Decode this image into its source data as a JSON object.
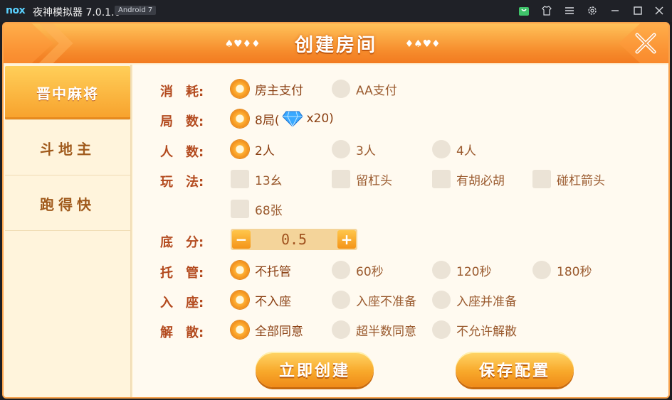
{
  "titlebar": {
    "logo": "nox",
    "app_title": "夜神模拟器 7.0.1.0",
    "android_badge": "Android 7",
    "icons": [
      "shop-icon",
      "shirt-icon",
      "menu-icon",
      "gear-icon",
      "minimize-icon",
      "maximize-icon",
      "close-icon"
    ]
  },
  "dialog": {
    "title": "创建房间",
    "close_icon": "close-x-icon"
  },
  "tabs": [
    {
      "label": "晋中麻将",
      "active": true
    },
    {
      "label": "斗地主",
      "active": false
    },
    {
      "label": "跑得快",
      "active": false
    }
  ],
  "form": {
    "consume": {
      "label": "消　耗:",
      "options": [
        {
          "label": "房主支付",
          "selected": true
        },
        {
          "label": "AA支付",
          "selected": false
        }
      ]
    },
    "rounds": {
      "label": "局　数:",
      "option_prefix": "8局(",
      "option_suffix": "x20)",
      "gem_icon": "diamond-icon",
      "selected": true
    },
    "players": {
      "label": "人　数:",
      "options": [
        {
          "label": "2人",
          "selected": true
        },
        {
          "label": "3人",
          "selected": false
        },
        {
          "label": "4人",
          "selected": false
        }
      ]
    },
    "play": {
      "label": "玩　法:",
      "options": [
        {
          "label": "13幺",
          "checked": false
        },
        {
          "label": "留杠头",
          "checked": false
        },
        {
          "label": "有胡必胡",
          "checked": false
        },
        {
          "label": "碰杠箭头",
          "checked": false
        },
        {
          "label": "68张",
          "checked": false
        }
      ]
    },
    "base_score": {
      "label": "底　分:",
      "value": "0.5",
      "minus": "−",
      "plus": "+"
    },
    "auto": {
      "label": "托　管:",
      "options": [
        {
          "label": "不托管",
          "selected": true
        },
        {
          "label": "60秒",
          "selected": false
        },
        {
          "label": "120秒",
          "selected": false
        },
        {
          "label": "180秒",
          "selected": false
        }
      ]
    },
    "seat": {
      "label": "入　座:",
      "options": [
        {
          "label": "不入座",
          "selected": true
        },
        {
          "label": "入座不准备",
          "selected": false
        },
        {
          "label": "入座并准备",
          "selected": false
        }
      ]
    },
    "dismiss": {
      "label": "解　散:",
      "options": [
        {
          "label": "全部同意",
          "selected": true
        },
        {
          "label": "超半数同意",
          "selected": false
        },
        {
          "label": "不允许解散",
          "selected": false
        }
      ]
    }
  },
  "buttons": {
    "create": "立即创建",
    "save": "保存配置"
  },
  "colors": {
    "accent": "#f7a12c",
    "label": "#b34a1e",
    "option_text": "#9a5a2e"
  }
}
